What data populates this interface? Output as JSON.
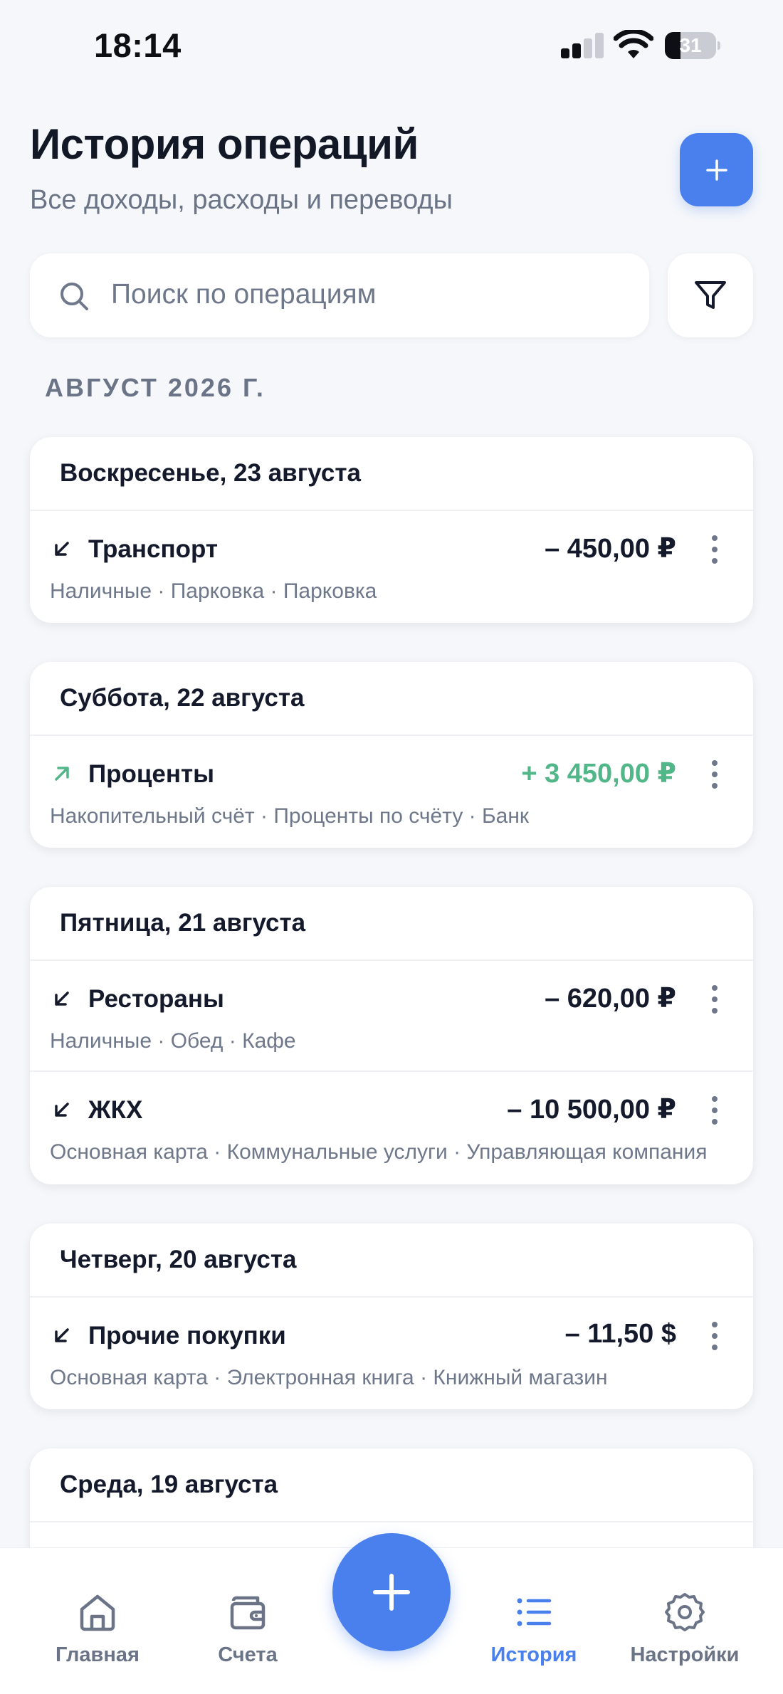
{
  "status_bar": {
    "time": "18:14",
    "battery_level": "31",
    "battery_fraction": 0.31
  },
  "header": {
    "title": "История операций",
    "subtitle": "Все доходы, расходы и переводы",
    "add_icon": "plus-icon"
  },
  "search": {
    "placeholder": "Поиск по операциям",
    "icon": "search-icon",
    "filter_icon": "filter-icon"
  },
  "month_label": "АВГУСТ 2026 Г.",
  "colors": {
    "accent": "#4a80ee",
    "income": "#52b788",
    "expense": "#141a2b",
    "muted": "#6f788b"
  },
  "days": [
    {
      "date": "Воскресенье, 23 августа",
      "transactions": [
        {
          "type": "expense",
          "category": "Транспорт",
          "amount": "– 450,00 ₽",
          "meta": "Наличные · Парковка · Парковка"
        }
      ]
    },
    {
      "date": "Суббота, 22 августа",
      "transactions": [
        {
          "type": "income",
          "category": "Проценты",
          "amount": "+ 3 450,00 ₽",
          "meta": "Накопительный счёт · Проценты по счёту · Банк"
        }
      ]
    },
    {
      "date": "Пятница, 21 августа",
      "transactions": [
        {
          "type": "expense",
          "category": "Рестораны",
          "amount": "– 620,00 ₽",
          "meta": "Наличные · Обед · Кафе"
        },
        {
          "type": "expense",
          "category": "ЖКХ",
          "amount": "– 10 500,00 ₽",
          "meta": "Основная карта · Коммунальные услуги · Управляющая компания"
        }
      ]
    },
    {
      "date": "Четверг, 20 августа",
      "transactions": [
        {
          "type": "expense",
          "category": "Прочие покупки",
          "amount": "– 11,50 $",
          "meta": "Основная карта · Электронная книга · Книжный магазин"
        }
      ]
    },
    {
      "date": "Среда, 19 августа",
      "transactions": []
    }
  ],
  "nav": {
    "items": [
      {
        "label": "Главная",
        "icon": "home-icon",
        "active": false
      },
      {
        "label": "Счета",
        "icon": "wallet-icon",
        "active": false
      },
      {
        "label": "История",
        "icon": "list-icon",
        "active": true
      },
      {
        "label": "Настройки",
        "icon": "gear-icon",
        "active": false
      }
    ],
    "fab_icon": "plus-icon"
  }
}
